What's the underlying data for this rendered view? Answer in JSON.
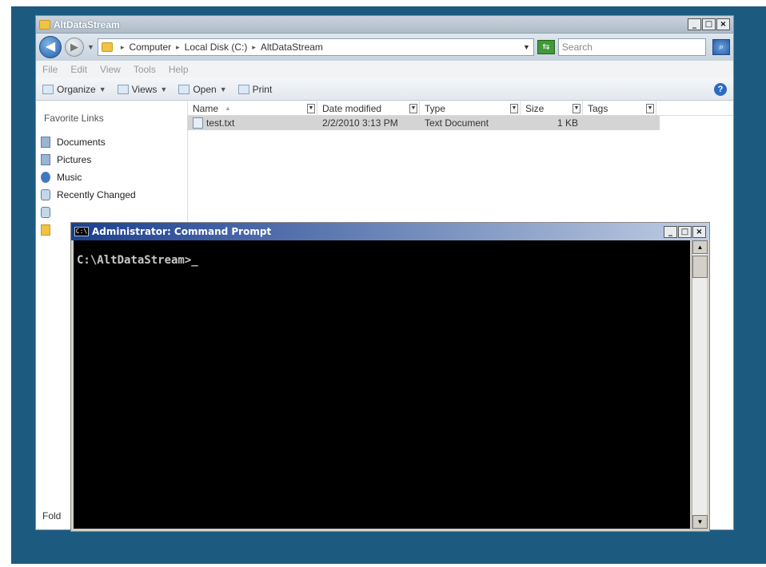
{
  "explorer": {
    "title": "AltDataStream",
    "window_buttons": [
      "_",
      "□",
      "×"
    ],
    "address": {
      "crumbs": [
        "Computer",
        "Local Disk (C:)",
        "AltDataStream"
      ],
      "search_placeholder": "Search"
    },
    "menu": [
      "File",
      "Edit",
      "View",
      "Tools",
      "Help"
    ],
    "toolbar": {
      "organize": "Organize",
      "views": "Views",
      "open": "Open",
      "print": "Print"
    },
    "nav": {
      "favorites_title": "Favorite Links",
      "items": [
        "Documents",
        "Pictures",
        "Music",
        "Recently Changed"
      ],
      "folders_label": "Fold"
    },
    "columns": [
      "Name",
      "Date modified",
      "Type",
      "Size",
      "Tags"
    ],
    "files": [
      {
        "name": "test.txt",
        "date": "2/2/2010 3:13 PM",
        "type": "Text Document",
        "size": "1 KB"
      }
    ]
  },
  "cmd": {
    "title": "Administrator: Command Prompt",
    "icon_text": "C:\\",
    "prompt": "C:\\AltDataStream>",
    "cursor": "_",
    "window_buttons": [
      "_",
      "□",
      "×"
    ]
  }
}
